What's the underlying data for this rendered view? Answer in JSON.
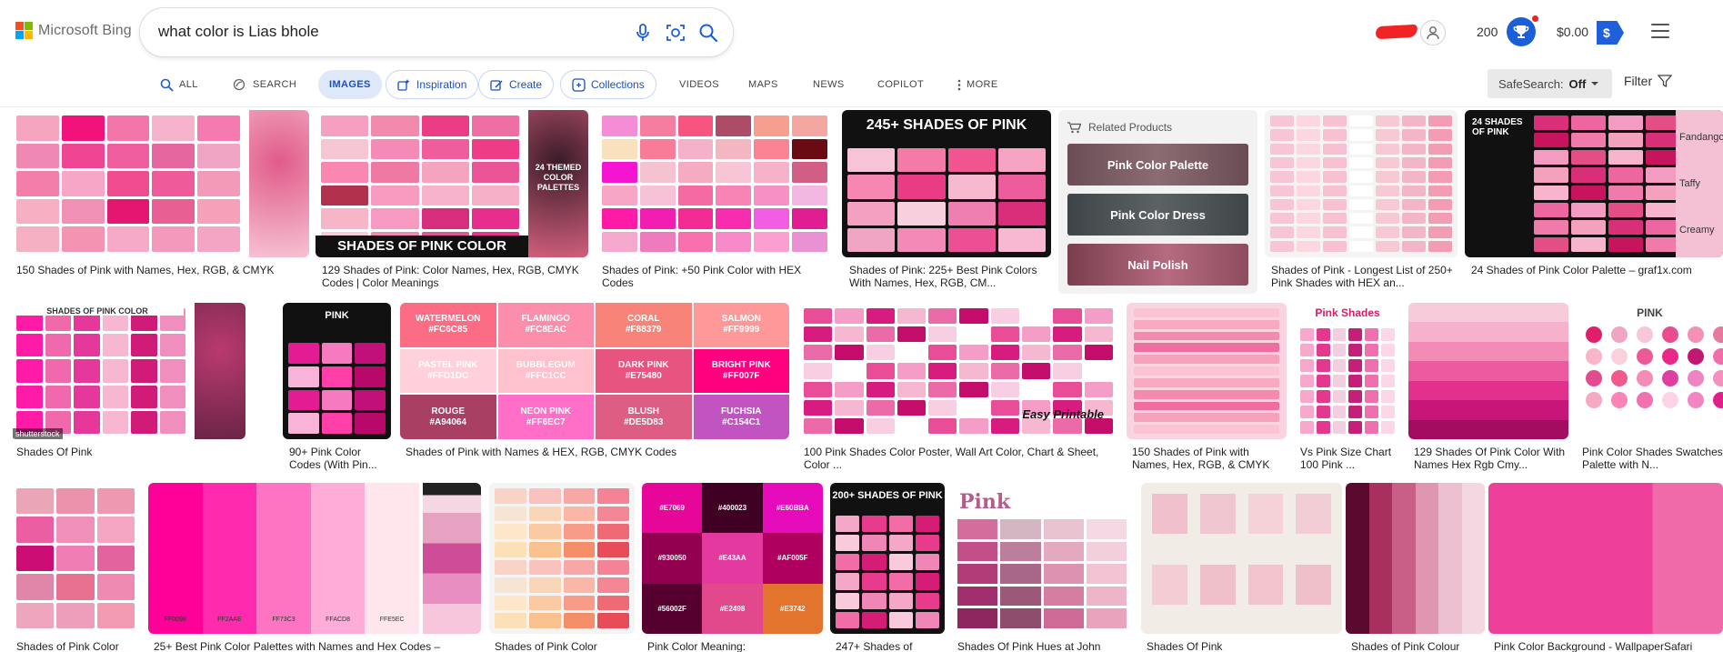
{
  "brand": {
    "name": "Microsoft Bing",
    "logo_colors": [
      "#f25022",
      "#7fba00",
      "#00a4ef",
      "#ffb900"
    ]
  },
  "search": {
    "query": "what color is Lias bhole"
  },
  "header": {
    "points": "200",
    "balance": "$0.00",
    "dollar_symbol": "$"
  },
  "nav": {
    "tabs": [
      {
        "label": "ALL",
        "icon": "search-icon"
      },
      {
        "label": "SEARCH",
        "icon": "copilot-search-icon"
      },
      {
        "label": "IMAGES",
        "icon": "",
        "active": true
      },
      {
        "label": "Inspiration",
        "icon": "inspiration-icon"
      },
      {
        "label": "Create",
        "icon": "create-icon"
      },
      {
        "label": "Collections",
        "icon": "collections-icon"
      },
      {
        "label": "VIDEOS",
        "icon": ""
      },
      {
        "label": "MAPS",
        "icon": ""
      },
      {
        "label": "NEWS",
        "icon": ""
      },
      {
        "label": "COPILOT",
        "icon": ""
      },
      {
        "label": "MORE",
        "icon": "more-vertical-icon"
      }
    ],
    "safesearch_label": "SafeSearch:",
    "safesearch_value": "Off",
    "filter_label": "Filter"
  },
  "related": {
    "title": "Related Products",
    "items": [
      "Pink Color Palette",
      "Pink Color Dress",
      "Nail Polish"
    ]
  },
  "results": [
    {
      "caption": "150 Shades of Pink with Names, Hex, RGB, & CMYK"
    },
    {
      "caption": "129 Shades of Pink: Color Names, Hex, RGB, CMYK Codes | Color Meanings",
      "overlay": "SHADES OF PINK COLOR",
      "side_overlay": "24 THEMED COLOR PALETTES"
    },
    {
      "caption": "Shades of Pink: +50 Pink Color with HEX Codes"
    },
    {
      "caption": "Shades of Pink: 225+ Best Pink Colors With Names, Hex, RGB, CM...",
      "overlay": "245+ SHADES OF PINK"
    },
    {
      "caption": "Shades of Pink - Longest List of 250+ Pink Shades with HEX an..."
    },
    {
      "caption": "24 Shades of Pink Color Palette – graf1x.com",
      "overlay": "24 SHADES OF PINK",
      "side_words": [
        "Fandango",
        "Taffy",
        "Creamy"
      ]
    },
    {
      "caption": "Shades Of Pink",
      "overlay": "SHADES OF PINK COLOR",
      "watermark": "shutterstock"
    },
    {
      "caption": "90+ Pink Color Codes (With Pin...",
      "overlay": "PINK"
    },
    {
      "caption": "Shades of Pink with Names & HEX, RGB, CMYK Codes",
      "swatches": [
        {
          "name": "WATERMELON",
          "hex": "#FC6C85"
        },
        {
          "name": "FLAMINGO",
          "hex": "#FC8EAC"
        },
        {
          "name": "CORAL",
          "hex": "#F88379"
        },
        {
          "name": "SALMON",
          "hex": "#FF9999"
        },
        {
          "name": "PASTEL PINK",
          "hex": "#FFD1DC"
        },
        {
          "name": "BUBBLEGUM",
          "hex": "#FFC1CC"
        },
        {
          "name": "DARK PINK",
          "hex": "#E75480"
        },
        {
          "name": "BRIGHT PINK",
          "hex": "#FF007F"
        },
        {
          "name": "ROUGE",
          "hex": "#A94064"
        },
        {
          "name": "NEON PINK",
          "hex": "#FF6EC7"
        },
        {
          "name": "BLUSH",
          "hex": "#DE5D83"
        },
        {
          "name": "FUCHSIA",
          "hex": "#C154C1"
        }
      ]
    },
    {
      "caption": "100 Pink Shades Color Poster, Wall Art Color, Chart & Sheet, Color ...",
      "overlay": "Easy Printable"
    },
    {
      "caption": "150 Shades of Pink with Names, Hex, RGB, & CMYK"
    },
    {
      "caption": "Vs Pink Size Chart 100 Pink ...",
      "overlay": "Pink Shades"
    },
    {
      "caption": "129 Shades Of Pink Color With Names Hex Rgb Cmy..."
    },
    {
      "caption": "Pink Color Shades Swatches Palette with N...",
      "overlay": "PINK"
    },
    {
      "caption": "Shades of Pink Color"
    },
    {
      "caption": "25+ Best Pink Color Palettes with Names and Hex Codes –",
      "codes": [
        "FF0098",
        "FF2AAE",
        "FF73C3",
        "FFACD8",
        "FFE5EC"
      ]
    },
    {
      "caption": "Shades of Pink Color"
    },
    {
      "caption": "Pink Color Meaning:",
      "codes": [
        "#E7069",
        "#400023",
        "#E60BBA",
        "#930050",
        "#E43AA",
        "#AF005F",
        "#56002F",
        "#E2498",
        "#E3742"
      ]
    },
    {
      "caption": "247+ Shades of",
      "overlay": "200+ SHADES OF PINK"
    },
    {
      "caption": "Shades Of Pink Hues at John",
      "overlay": "Pink"
    },
    {
      "caption": "Shades Of Pink"
    },
    {
      "caption": "Shades of Pink Colour"
    },
    {
      "caption": "Pink Color Background - WallpaperSafari"
    }
  ]
}
